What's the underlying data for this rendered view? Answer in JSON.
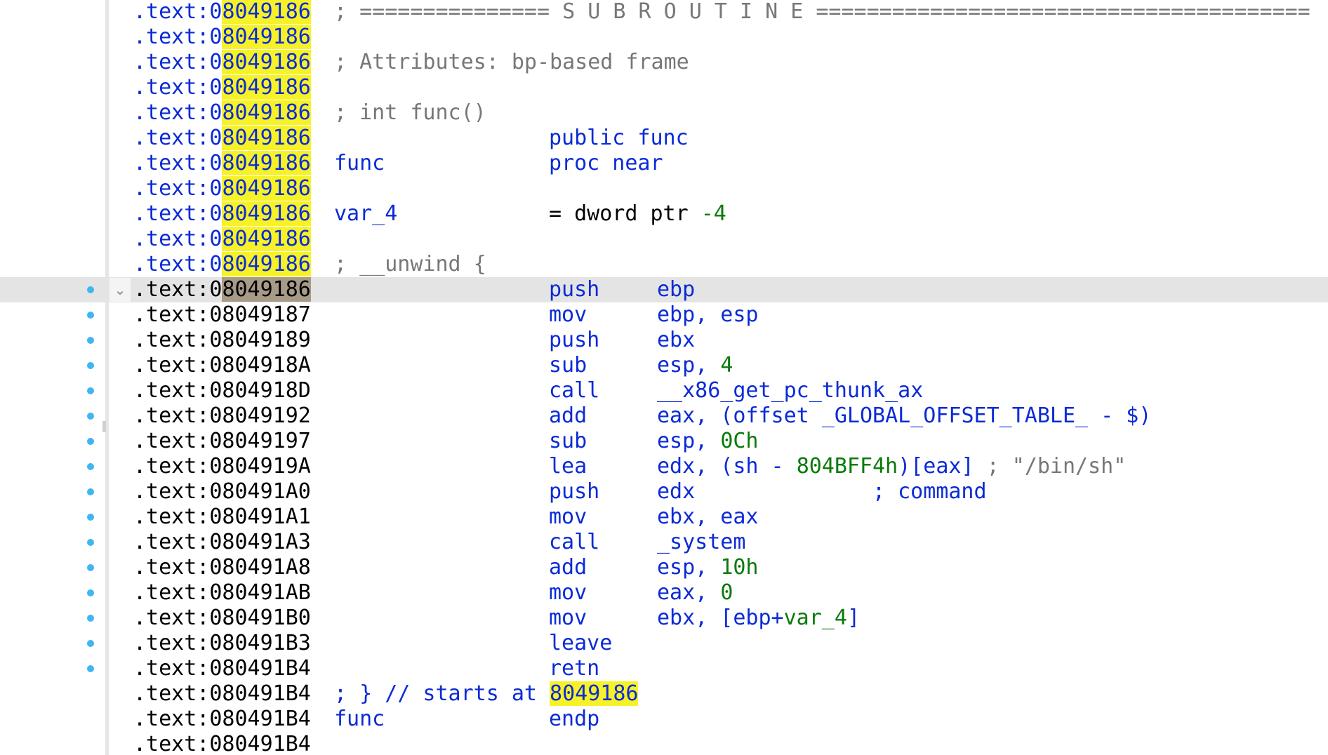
{
  "colors": {
    "address_blue": "#0b2bd6",
    "highlight_yellow": "#f7f227",
    "current_line": "#e4e4e4",
    "breakpoint_dot": "#3fb6f2",
    "immediate_green": "#0a7a0a",
    "comment_gray": "#777777"
  },
  "icons": {
    "collapse": "chevron-down-icon",
    "line_marker": "dot-icon"
  },
  "collapse_glyph": "⌄",
  "lines": [
    {
      "seg": ".text:",
      "addr_pre": "0",
      "addr": "8049186",
      "comment": "; =============== S U B R O U T I N E ======================================="
    },
    {
      "seg": ".text:",
      "addr_pre": "0",
      "addr": "8049186"
    },
    {
      "seg": ".text:",
      "addr_pre": "0",
      "addr": "8049186",
      "comment": "; Attributes: bp-based frame"
    },
    {
      "seg": ".text:",
      "addr_pre": "0",
      "addr": "8049186"
    },
    {
      "seg": ".text:",
      "addr_pre": "0",
      "addr": "8049186",
      "comment": "; int func()"
    },
    {
      "seg": ".text:",
      "addr_pre": "0",
      "addr": "8049186",
      "mnem": "public func"
    },
    {
      "seg": ".text:",
      "addr_pre": "0",
      "addr": "8049186",
      "name": "func",
      "mnem": "proc near"
    },
    {
      "seg": ".text:",
      "addr_pre": "0",
      "addr": "8049186"
    },
    {
      "seg": ".text:",
      "addr_pre": "0",
      "addr": "8049186",
      "name": "var_4",
      "eq": "= dword ptr",
      "eq_num": "-4"
    },
    {
      "seg": ".text:",
      "addr_pre": "0",
      "addr": "8049186"
    },
    {
      "seg": ".text:",
      "addr_pre": "0",
      "addr": "8049186",
      "comment": "; __unwind {"
    }
  ],
  "code": [
    {
      "seg": ".text:",
      "addr": "08049186",
      "addr_pre": "0",
      "addr_rest": "8049186",
      "mnem": "push",
      "op": "ebp"
    },
    {
      "seg": ".text:",
      "addr": "08049187",
      "mnem": "mov",
      "op": "ebp, esp"
    },
    {
      "seg": ".text:",
      "addr": "08049189",
      "mnem": "push",
      "op": "ebx"
    },
    {
      "seg": ".text:",
      "addr": "0804918A",
      "mnem": "sub",
      "op_a": "esp, ",
      "op_num": "4"
    },
    {
      "seg": ".text:",
      "addr": "0804918D",
      "mnem": "call",
      "op_link": "__x86_get_pc_thunk_ax"
    },
    {
      "seg": ".text:",
      "addr": "08049192",
      "mnem": "add",
      "op_a": "eax, (offset ",
      "op_link": "_GLOBAL_OFFSET_TABLE_",
      "op_b": " - $)"
    },
    {
      "seg": ".text:",
      "addr": "08049197",
      "mnem": "sub",
      "op_a": "esp, ",
      "op_num": "0Ch"
    },
    {
      "seg": ".text:",
      "addr": "0804919A",
      "mnem": "lea",
      "op_a": "edx, (",
      "op_link": "sh",
      "op_b": " - ",
      "op_num": "804BFF4h",
      "op_c": ")[eax]",
      "op_cmt": " ; \"/bin/sh\""
    },
    {
      "seg": ".text:",
      "addr": "080491A0",
      "mnem": "push",
      "op": "edx",
      "cmd_semicolon": ";",
      "cmd_text": "command"
    },
    {
      "seg": ".text:",
      "addr": "080491A1",
      "mnem": "mov",
      "op": "ebx, eax"
    },
    {
      "seg": ".text:",
      "addr": "080491A3",
      "mnem": "call",
      "op_link": "_system"
    },
    {
      "seg": ".text:",
      "addr": "080491A8",
      "mnem": "add",
      "op_a": "esp, ",
      "op_num": "10h"
    },
    {
      "seg": ".text:",
      "addr": "080491AB",
      "mnem": "mov",
      "op_a": "eax, ",
      "op_num": "0"
    },
    {
      "seg": ".text:",
      "addr": "080491B0",
      "mnem": "mov",
      "op_a": "ebx, [ebp+",
      "op_green": "var_4",
      "op_b": "]"
    },
    {
      "seg": ".text:",
      "addr": "080491B3",
      "mnem": "leave"
    },
    {
      "seg": ".text:",
      "addr": "080491B4",
      "mnem": "retn"
    }
  ],
  "tail": [
    {
      "seg": ".text:",
      "addr": "080491B4",
      "blue_text": "; } // starts at ",
      "hl_text": "8049186"
    },
    {
      "seg": ".text:",
      "addr": "080491B4",
      "name": "func",
      "mnem": "endp"
    },
    {
      "seg": ".text:",
      "addr": "080491B4"
    }
  ]
}
